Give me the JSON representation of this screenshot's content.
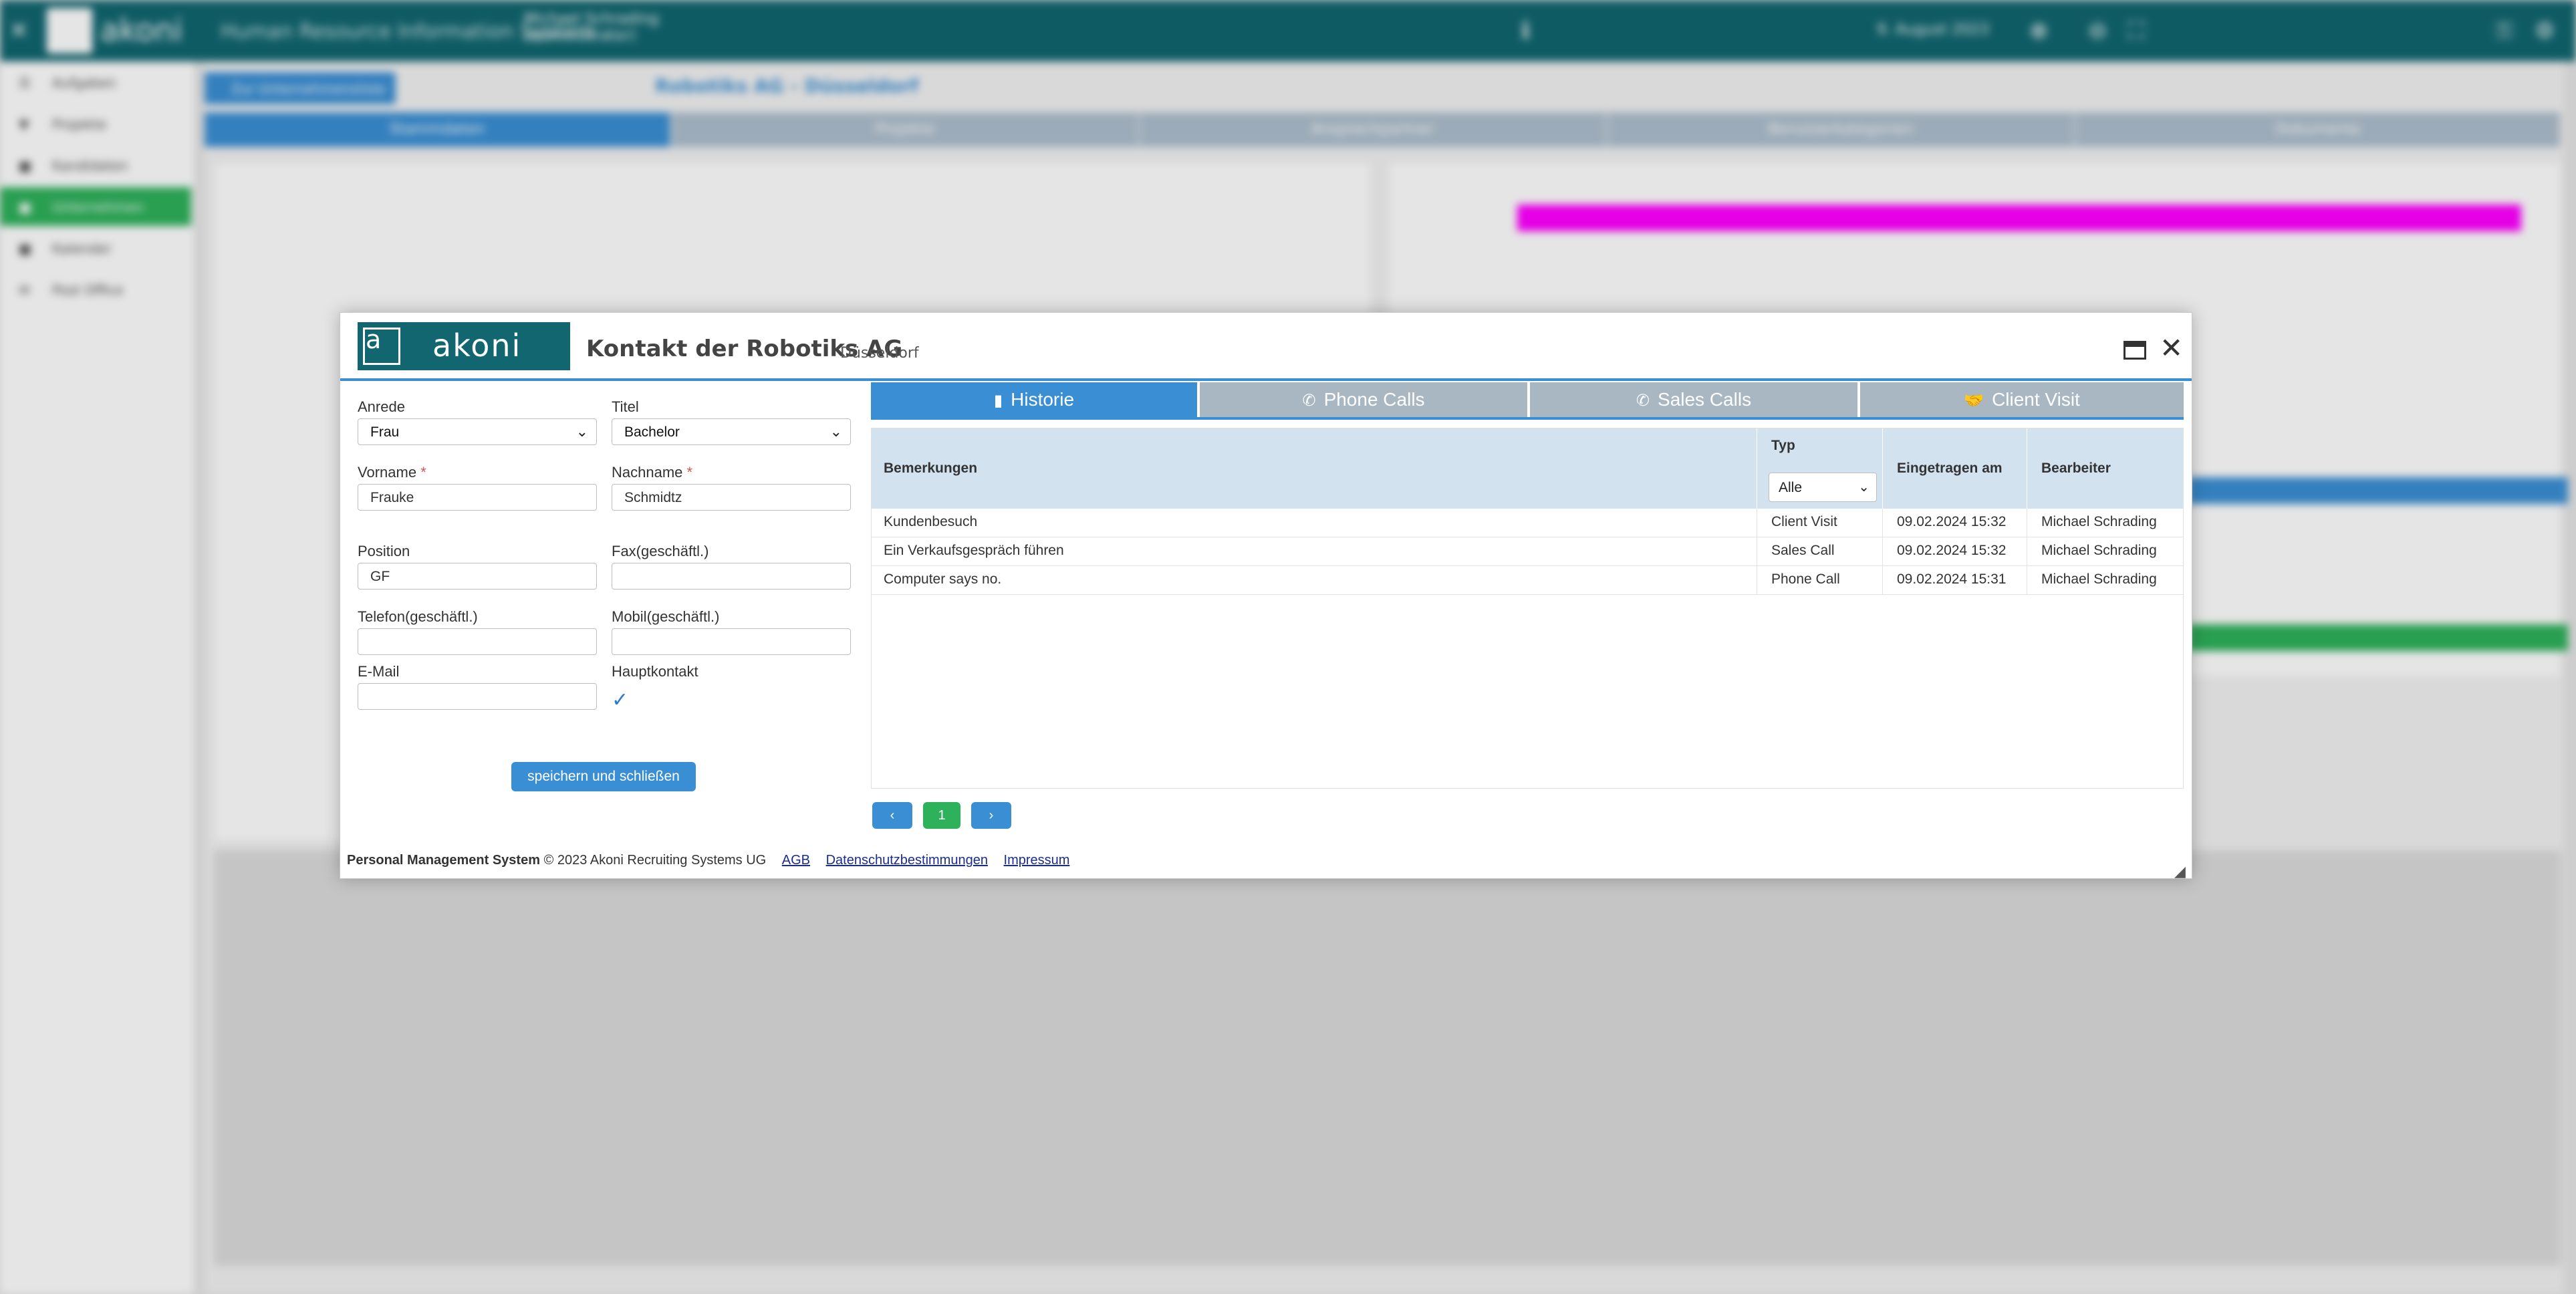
{
  "background": {
    "app_name": "Human Resource Information System",
    "logo_text": "akoni",
    "user_name": "Michael Schrading",
    "user_role": "(Administrator)",
    "date": "9. August 2023",
    "back_button": "Zur Unternehmensliste",
    "page_title": "Robotiks AG - Düsseldorf",
    "sidebar": [
      {
        "label": "Aufgaben"
      },
      {
        "label": "Projekte"
      },
      {
        "label": "Kandidaten"
      },
      {
        "label": "Unternehmen"
      },
      {
        "label": "Kalender"
      },
      {
        "label": "Post Office"
      }
    ],
    "tabs": [
      "Stammdaten",
      "Projekte",
      "Ansprechpartner",
      "Benutzerkategorien",
      "Dokumente"
    ]
  },
  "modal": {
    "logo_text": "akoni",
    "logo_letter": "a",
    "title": "Kontakt der Robotiks AG",
    "location": "Düsseldorf",
    "form": {
      "anrede_label": "Anrede",
      "anrede_value": "Frau",
      "titel_label": "Titel",
      "titel_value": "Bachelor",
      "vorname_label": "Vorname",
      "vorname_value": "Frauke",
      "nachname_label": "Nachname",
      "nachname_value": "Schmidtz",
      "required_mark": "*",
      "position_label": "Position",
      "position_value": "GF",
      "fax_label": "Fax(geschäftl.)",
      "fax_value": "",
      "telefon_label": "Telefon(geschäftl.)",
      "telefon_value": "",
      "mobil_label": "Mobil(geschäftl.)",
      "mobil_value": "",
      "email_label": "E-Mail",
      "email_value": "",
      "hauptkontakt_label": "Hauptkontakt",
      "hauptkontakt_checked": true,
      "save_label": "speichern und schließen"
    },
    "tabs": [
      {
        "label": "Historie",
        "icon": "book-icon",
        "active": true
      },
      {
        "label": "Phone Calls",
        "icon": "phone-icon",
        "active": false
      },
      {
        "label": "Sales Calls",
        "icon": "phone-icon",
        "active": false
      },
      {
        "label": "Client Visit",
        "icon": "handshake-icon",
        "active": false
      }
    ],
    "table": {
      "headers": {
        "bemerkungen": "Bemerkungen",
        "typ": "Typ",
        "eingetragen": "Eingetragen am",
        "bearbeiter": "Bearbeiter"
      },
      "type_filter": "Alle",
      "rows": [
        {
          "bemerkung": "Kundenbesuch",
          "typ": "Client Visit",
          "datum": "09.02.2024 15:32",
          "bearbeiter": "Michael Schrading"
        },
        {
          "bemerkung": "Ein Verkaufsgespräch führen",
          "typ": "Sales Call",
          "datum": "09.02.2024 15:32",
          "bearbeiter": "Michael Schrading"
        },
        {
          "bemerkung": "Computer says no.",
          "typ": "Phone Call",
          "datum": "09.02.2024 15:31",
          "bearbeiter": "Michael Schrading"
        }
      ]
    },
    "pagination": {
      "prev": "‹",
      "current": "1",
      "next": "›"
    },
    "footer": {
      "system": "Personal Management System",
      "copyright": "© 2023 Akoni Recruiting Systems UG",
      "agb": "AGB",
      "datenschutz": "Datenschutzbestimmungen",
      "impressum": "Impressum"
    }
  },
  "colors": {
    "brand": "#116670",
    "accent": "#3a8fd4",
    "active_green": "#2eb15b",
    "tab_inactive": "#a9b7c3",
    "table_header": "#d3e2ef"
  }
}
